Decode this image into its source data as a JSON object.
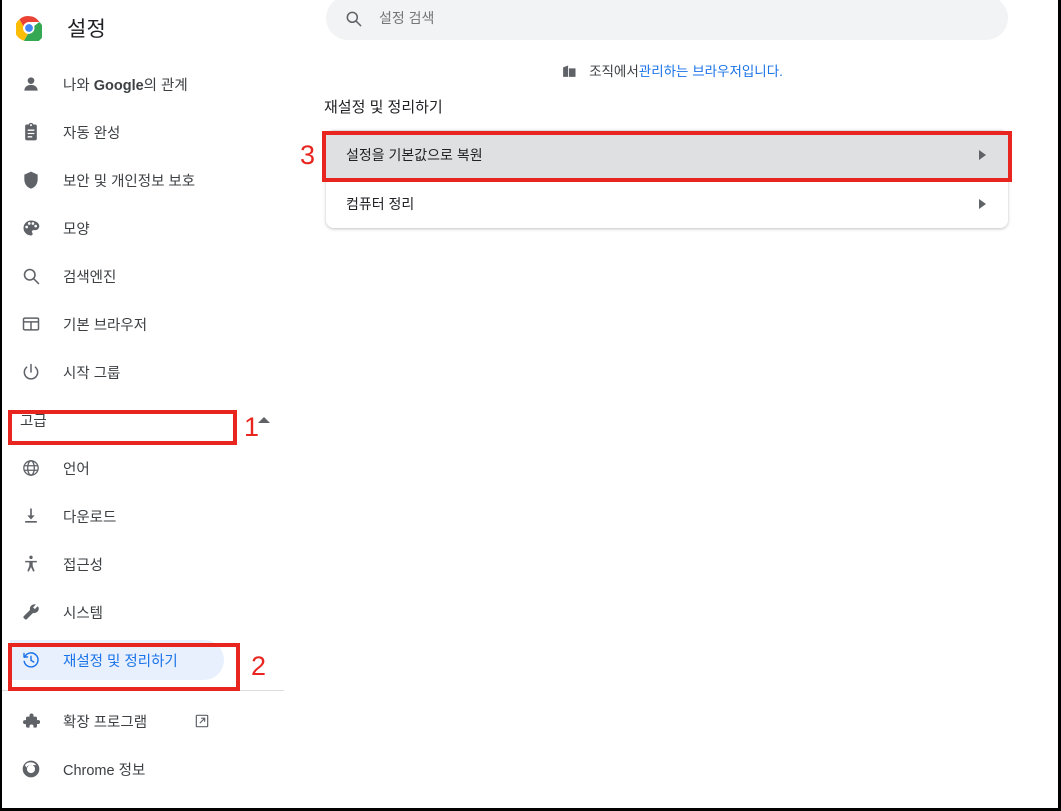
{
  "window": {
    "title": "설정",
    "brand_icon": "chrome-logo-icon"
  },
  "search": {
    "placeholder": "설정 검색",
    "value": "",
    "icon": "search-icon"
  },
  "managed_note": {
    "icon": "organization-building-icon",
    "prefix": "조직에서 ",
    "link": "관리하는 브라우저입니다."
  },
  "sidebar": {
    "items": [
      {
        "label_html": "나와 <b>Google</b>의 관계",
        "label": "나와 Google의 관계",
        "icon": "person-icon",
        "name": "you-and-google",
        "selected": false
      },
      {
        "label": "자동 완성",
        "icon": "clipboard-icon",
        "name": "autofill",
        "selected": false
      },
      {
        "label": "보안 및 개인정보 보호",
        "icon": "shield-icon",
        "name": "privacy-and-security",
        "selected": false
      },
      {
        "label": "모양",
        "icon": "palette-icon",
        "name": "appearance",
        "selected": false
      },
      {
        "label": "검색엔진",
        "icon": "search-icon",
        "name": "search-engine",
        "selected": false
      },
      {
        "label": "기본 브라우저",
        "icon": "browser-window-icon",
        "name": "default-browser",
        "selected": false
      },
      {
        "label": "시작 그룹",
        "icon": "power-icon",
        "name": "on-startup",
        "selected": false
      }
    ],
    "expander": {
      "label": "고급",
      "icon": "chevron-up-icon",
      "expanded": true
    },
    "advanced_items": [
      {
        "label": "언어",
        "icon": "globe-icon",
        "name": "languages",
        "selected": false
      },
      {
        "label": "다운로드",
        "icon": "download-icon",
        "name": "downloads",
        "selected": false
      },
      {
        "label": "접근성",
        "icon": "accessibility-icon",
        "name": "accessibility",
        "selected": false
      },
      {
        "label": "시스템",
        "icon": "wrench-icon",
        "name": "system",
        "selected": false
      },
      {
        "label": "재설정 및 정리하기",
        "icon": "restore-history-icon",
        "name": "reset-and-cleanup",
        "selected": true
      }
    ],
    "footer_items": [
      {
        "label": "확장 프로그램",
        "icon": "puzzle-icon",
        "name": "extensions",
        "external": true,
        "external_icon": "external-link-icon"
      },
      {
        "label": "Chrome 정보",
        "icon": "chrome-outline-icon",
        "name": "about-chrome",
        "external": false
      }
    ]
  },
  "main": {
    "section_title": "재설정 및 정리하기",
    "rows": [
      {
        "label": "설정을 기본값으로 복원",
        "name": "restore-settings-to-defaults",
        "arrow_icon": "chevron-right-icon",
        "hovered": true
      },
      {
        "label": "컴퓨터 정리",
        "name": "clean-up-computer",
        "arrow_icon": "chevron-right-icon",
        "hovered": false
      }
    ]
  },
  "annotations": {
    "accent_color": "#e8251f",
    "steps": [
      {
        "number": "1",
        "target": "고급"
      },
      {
        "number": "2",
        "target": "재설정 및 정리하기"
      },
      {
        "number": "3",
        "target": "설정을 기본값으로 복원"
      }
    ]
  },
  "colors": {
    "accent_blue": "#1a73e8",
    "selected_pill": "#e8f0fe",
    "search_bg": "#f1f3f4",
    "annotation_red": "#e8251f",
    "row_hover": "#dfe0e1"
  }
}
